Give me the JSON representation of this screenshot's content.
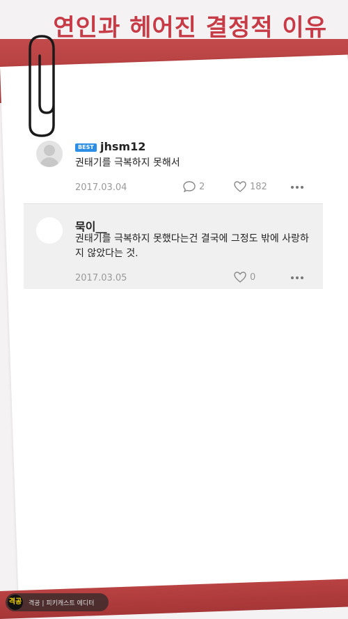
{
  "title": "연인과 헤어진 결정적 이유",
  "comments": [
    {
      "badge": "BEST",
      "nickname": "jhsm12",
      "text": "권태기를 극복하지 못해서",
      "date": "2017.03.04",
      "reply_count": "2",
      "like_count": "182"
    },
    {
      "nickname": "묵이__",
      "text": "권태기를 극복하지 못했다는건 결국에 그정도 밖에 사랑하지 않았다는 것.",
      "date": "2017.03.05",
      "like_count": "0"
    }
  ],
  "watermark": {
    "logo": "격공",
    "text": "격공 | 피키캐스트 에디터"
  },
  "colors": {
    "accent_red": "#b43e3f",
    "title_red": "#c63b46",
    "best_badge": "#2c8fe5"
  },
  "icons": [
    "paperclip-icon",
    "default-avatar-icon",
    "reply-icon",
    "heart-icon",
    "more-icon"
  ]
}
